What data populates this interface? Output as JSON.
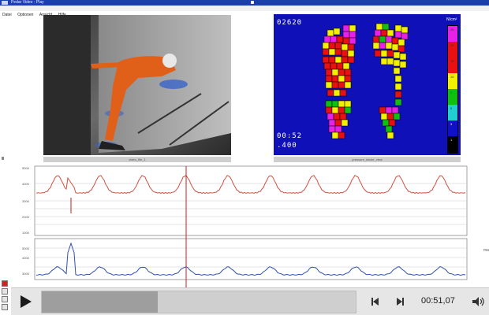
{
  "window": {
    "caption": "Pedar Video - Play"
  },
  "menu": [
    "Datei",
    "Optionen",
    "Ansicht",
    "Hilfe"
  ],
  "video": {
    "caption": "video_file_1"
  },
  "pressure": {
    "counter": "02620",
    "time": "00:52",
    "ms": ".400",
    "unit": "N/cm²",
    "caption": "pressure_insole_view",
    "scale_colors": [
      "#e820e8",
      "#e81010",
      "#e81010",
      "#f0f000",
      "#10c010",
      "#20d0d0",
      "#1010c8",
      "#000000"
    ],
    "scale_values": [
      "25",
      "20",
      "15",
      "10",
      "7",
      "5",
      "3",
      "1"
    ]
  },
  "graph": {
    "top_series_color": "#d05040",
    "bottom_series_color": "#3050b0",
    "cursor_color": "#c02020",
    "top_axis": [
      "5000",
      "4000",
      "3000",
      "2000",
      "1000"
    ],
    "bottom_axis": [
      "5000",
      "4000",
      "3000"
    ],
    "side_label": "max"
  },
  "controls": {
    "time": "00:51,07",
    "progress": 0.37
  },
  "icons": {
    "play": "play-icon",
    "back": "skip-back-icon",
    "forward": "skip-forward-icon",
    "volume": "volume-icon"
  }
}
